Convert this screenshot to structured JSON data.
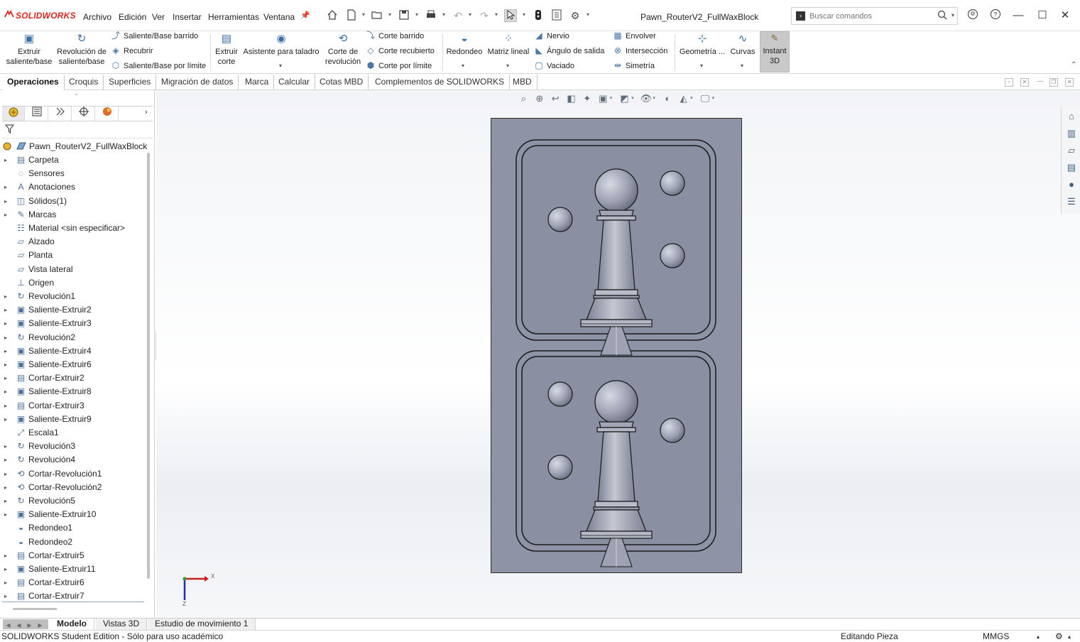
{
  "app": {
    "logo_text": "SOLIDWORKS",
    "document_title": "Pawn_RouterV2_FullWaxBlock",
    "menu": [
      "Archivo",
      "Edición",
      "Ver",
      "Insertar",
      "Herramientas",
      "Ventana"
    ],
    "search_placeholder": "Buscar comandos"
  },
  "ribbon": {
    "extruir": "Extruir saliente/base",
    "revolucion": "Revolución de saliente/base",
    "barrido": "Saliente/Base barrido",
    "recubrir": "Recubrir",
    "limite": "Saliente/Base por límite",
    "extruir_corte": "Extruir corte",
    "asistente": "Asistente para taladro",
    "corte_revolucion": "Corte de revolución",
    "corte_barrido": "Corte barrido",
    "corte_recubierto": "Corte recubierto",
    "corte_limite": "Corte por límite",
    "redondeo": "Redondeo",
    "matriz": "Matriz lineal",
    "nervio": "Nervio",
    "angulo": "Ángulo de salida",
    "vaciado": "Vaciado",
    "envolver": "Envolver",
    "interseccion": "Intersección",
    "simetria": "Simetría",
    "geometria": "Geometría ...",
    "curvas": "Curvas",
    "instant3d": "Instant 3D"
  },
  "tabs": [
    "Operaciones",
    "Croquis",
    "Superficies",
    "Migración de datos",
    "Marca",
    "Calcular",
    "Cotas MBD",
    "Complementos de SOLIDWORKS",
    "MBD"
  ],
  "tree": {
    "root": "Pawn_RouterV2_FullWaxBlock",
    "items": [
      {
        "label": "Carpeta",
        "icon": "folder-icon",
        "expand": true
      },
      {
        "label": "Sensores",
        "icon": "sensor-icon",
        "expand": false
      },
      {
        "label": "Anotaciones",
        "icon": "annotation-icon",
        "expand": true
      },
      {
        "label": "Sólidos(1)",
        "icon": "solid-bodies-icon",
        "expand": true
      },
      {
        "label": "Marcas",
        "icon": "markup-icon",
        "expand": true
      },
      {
        "label": "Material <sin especificar>",
        "icon": "material-icon",
        "expand": false
      },
      {
        "label": "Alzado",
        "icon": "plane-icon",
        "expand": false
      },
      {
        "label": "Planta",
        "icon": "plane-icon",
        "expand": false
      },
      {
        "label": "Vista lateral",
        "icon": "plane-icon",
        "expand": false
      },
      {
        "label": "Origen",
        "icon": "origin-icon",
        "expand": false
      },
      {
        "label": "Revolución1",
        "icon": "revolve-icon",
        "expand": true
      },
      {
        "label": "Saliente-Extruir2",
        "icon": "extrude-icon",
        "expand": true
      },
      {
        "label": "Saliente-Extruir3",
        "icon": "extrude-icon",
        "expand": true
      },
      {
        "label": "Revolución2",
        "icon": "revolve-icon",
        "expand": true
      },
      {
        "label": "Saliente-Extruir4",
        "icon": "extrude-icon",
        "expand": true
      },
      {
        "label": "Saliente-Extruir6",
        "icon": "extrude-icon",
        "expand": true
      },
      {
        "label": "Cortar-Extruir2",
        "icon": "cut-extrude-icon",
        "expand": true
      },
      {
        "label": "Saliente-Extruir8",
        "icon": "extrude-icon",
        "expand": true
      },
      {
        "label": "Cortar-Extruir3",
        "icon": "cut-extrude-icon",
        "expand": true
      },
      {
        "label": "Saliente-Extruir9",
        "icon": "extrude-icon",
        "expand": true
      },
      {
        "label": "Escala1",
        "icon": "scale-icon",
        "expand": false
      },
      {
        "label": "Revolución3",
        "icon": "revolve-icon",
        "expand": true
      },
      {
        "label": "Revolución4",
        "icon": "revolve-icon",
        "expand": true
      },
      {
        "label": "Cortar-Revolución1",
        "icon": "cut-revolve-icon",
        "expand": true
      },
      {
        "label": "Cortar-Revolución2",
        "icon": "cut-revolve-icon",
        "expand": true
      },
      {
        "label": "Revolución5",
        "icon": "revolve-icon",
        "expand": true
      },
      {
        "label": "Saliente-Extruir10",
        "icon": "extrude-icon",
        "expand": true
      },
      {
        "label": "Redondeo1",
        "icon": "fillet-icon",
        "expand": false
      },
      {
        "label": "Redondeo2",
        "icon": "fillet-icon",
        "expand": false
      },
      {
        "label": "Cortar-Extruir5",
        "icon": "cut-extrude-icon",
        "expand": true
      },
      {
        "label": "Saliente-Extruir11",
        "icon": "extrude-icon",
        "expand": true
      },
      {
        "label": "Cortar-Extruir6",
        "icon": "cut-extrude-icon",
        "expand": true
      },
      {
        "label": "Cortar-Extruir7",
        "icon": "cut-extrude-icon",
        "expand": true
      }
    ]
  },
  "triad": {
    "x": "X",
    "z": "Z"
  },
  "bottom_tabs": [
    "Modelo",
    "Vistas 3D",
    "Estudio de movimiento 1"
  ],
  "status": {
    "edition": "SOLIDWORKS Student Edition - Sólo para uso académico",
    "mode": "Editando Pieza",
    "units": "MMGS"
  },
  "colors": {
    "model_fill": "#8e93a5",
    "model_edge": "#1a1a1a",
    "brand_red": "#d9261c",
    "instant3d_active": "#c9c9c9"
  }
}
